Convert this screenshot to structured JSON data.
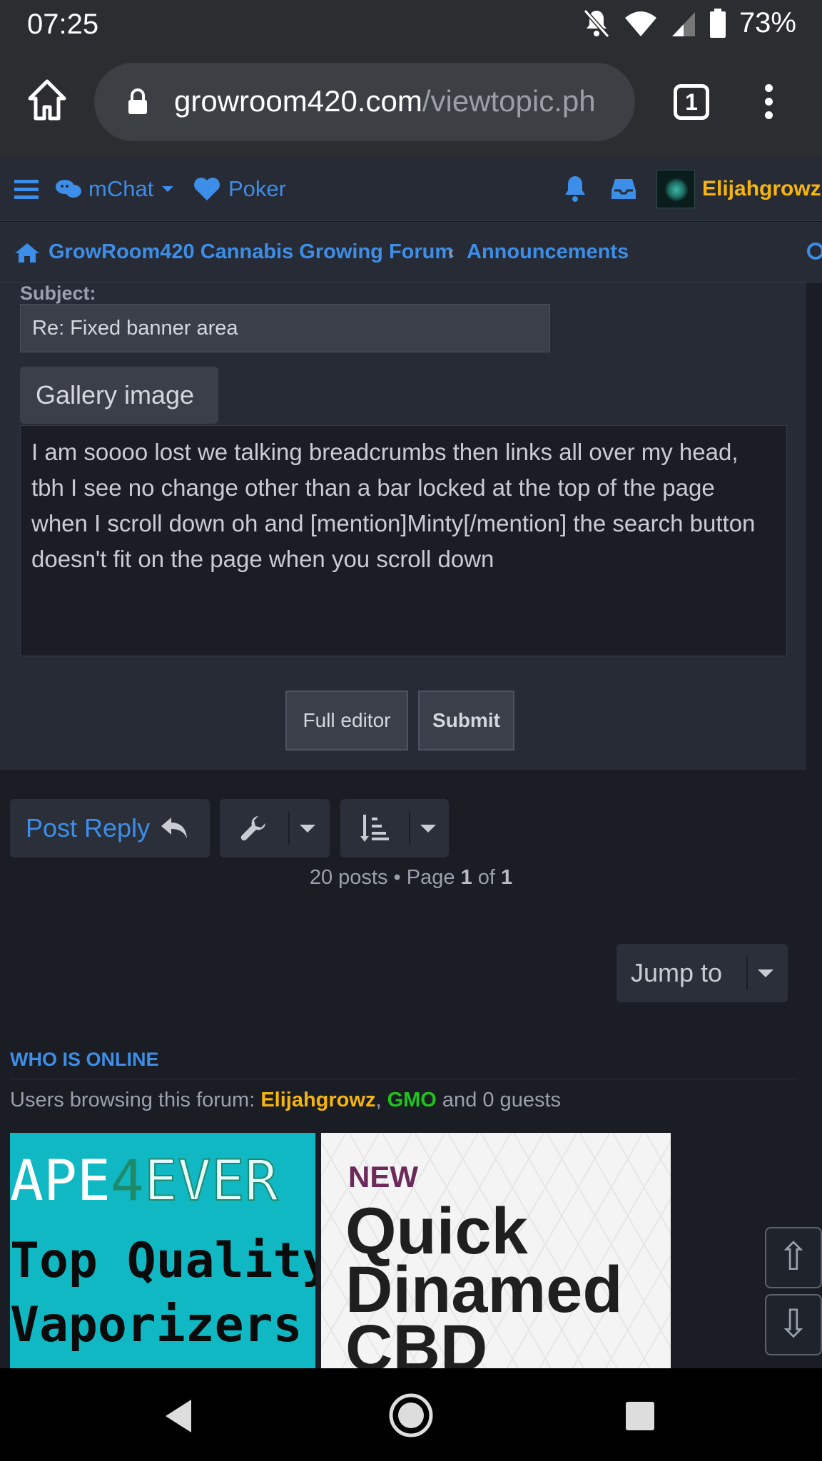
{
  "status_bar": {
    "time": "07:25",
    "battery": "73%"
  },
  "browser": {
    "url_domain": "growroom420.com",
    "url_path": "/viewtopic.ph",
    "tab_count": "1"
  },
  "nav": {
    "mchat_label": "mChat",
    "poker_label": "Poker",
    "username": "Elijahgrowz"
  },
  "breadcrumb": {
    "home": "GrowRoom420 Cannabis Growing Forum",
    "separator": "‹",
    "current": "Announcements"
  },
  "reply_form": {
    "subject_label": "Subject:",
    "subject_value": "Re: Fixed banner area",
    "gallery_button": "Gallery image",
    "message": "I am soooo lost we talking breadcrumbs then links all over my head, tbh I see no change other than a bar locked at the top of the page when I scroll down oh and [mention]Minty[/mention] the search button doesn't fit on the page when you scroll down",
    "full_editor_button": "Full editor",
    "submit_button": "Submit"
  },
  "actions": {
    "post_reply": "Post Reply",
    "posts_count": "20 posts",
    "bullet": "•",
    "page_word": "Page",
    "page_current": "1",
    "of_word": "of",
    "page_total": "1",
    "jump_to": "Jump to"
  },
  "who_is_online": {
    "heading": "WHO IS ONLINE",
    "prefix": "Users browsing this forum: ",
    "user1": "Elijahgrowz",
    "comma": ", ",
    "user2": "GMO",
    "suffix": " and 0 guests"
  },
  "ads": {
    "ad1_part1": "APE",
    "ad1_part2": "4",
    "ad1_part3": "EVER",
    "ad1_line2": "Top Quality",
    "ad1_line3": "Vaporizers",
    "ad2_new": "NEW",
    "ad2_line1": "Quick",
    "ad2_line2": "Dinamed",
    "ad2_line3": "CBD"
  },
  "scroll_buttons": {
    "up": "⇧",
    "down": "⇩"
  },
  "colors": {
    "accent_blue": "#3d8ee8",
    "username_gold": "#f5b50c",
    "online_green": "#21c21c",
    "panel_bg": "#262b36",
    "page_bg": "#1a1d24"
  },
  "icons": [
    "home-icon",
    "lock-icon",
    "hamburger-icon",
    "chat-icon",
    "heart-icon",
    "bell-icon",
    "inbox-icon",
    "search-icon",
    "reply-arrow-icon",
    "wrench-icon",
    "sort-icon",
    "back-icon",
    "circle-home-icon",
    "recents-icon"
  ]
}
